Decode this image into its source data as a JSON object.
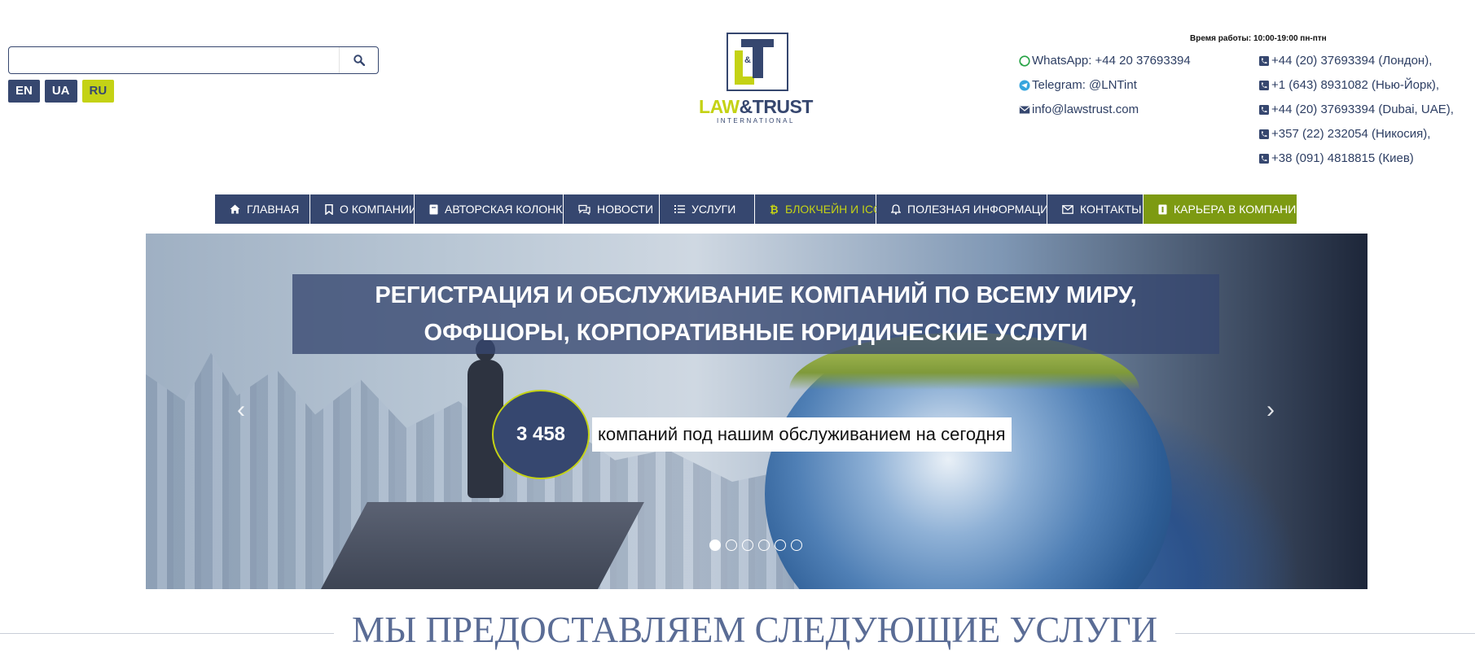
{
  "search": {
    "placeholder": "",
    "value": "",
    "icon": "search-icon"
  },
  "languages": [
    {
      "label": "EN",
      "active": false
    },
    {
      "label": "UA",
      "active": false
    },
    {
      "label": "RU",
      "active": true
    }
  ],
  "brand": {
    "accent": "#c4d215",
    "primary": "#36476f",
    "career_bg": "#7d9a12",
    "logo_word_1": "LAW",
    "logo_word_2": "&TRUST",
    "logo_sub": "INTERNATIONAL",
    "logo_amp": "&"
  },
  "contacts": {
    "hours": "Время работы: 10:00-19:00 пн-птн",
    "whatsapp": "WhatsApp: +44 20 37693394",
    "telegram": "Telegram: @LNTint",
    "email": "info@lawstrust.com",
    "phones": [
      "+44 (20) 37693394 (Лондон),",
      "+1 (643) 8931082 (Нью-Йорк),",
      "+44 (20) 37693394 (Dubai, UAE),",
      "+357 (22) 232054 (Никосия),",
      "+38 (091) 4818815 (Киев)"
    ]
  },
  "nav": {
    "items": [
      {
        "label": "ГЛАВНАЯ",
        "icon": "home-icon"
      },
      {
        "label": "О КОМПАНИИ",
        "icon": "bookmark-icon"
      },
      {
        "label": "АВТОРСКАЯ КОЛОНКА",
        "icon": "book-icon"
      },
      {
        "label": "НОВОСТИ",
        "icon": "chat-icon"
      },
      {
        "label": "УСЛУГИ",
        "icon": "list-icon"
      },
      {
        "label": "БЛОКЧЕЙН И ICO",
        "icon": "bitcoin-icon"
      },
      {
        "label": "ПОЛЕЗНАЯ ИНФОРМАЦИЯ",
        "icon": "bell-icon"
      },
      {
        "label": "КОНТАКТЫ",
        "icon": "envelope-icon"
      },
      {
        "label": "КАРЬЕРА В КОМПАНИИ",
        "icon": "badge-icon"
      }
    ]
  },
  "slider": {
    "headline_line_1": "РЕГИСТРАЦИЯ И ОБСЛУЖИВАНИЕ КОМПАНИЙ ПО ВСЕМУ МИРУ,",
    "headline_line_2": "ОФФШОРЫ, КОРПОРАТИВНЫЕ ЮРИДИЧЕСКИЕ УСЛУГИ",
    "counter": "3 458",
    "counter_label": "компаний под нашим обслуживанием на сегодня",
    "prev": "‹",
    "next": "›",
    "slides_total": 6,
    "active_slide": 1
  },
  "section": {
    "title": "МЫ ПРЕДОСТАВЛЯЕМ СЛЕДУЮЩИЕ УСЛУГИ"
  }
}
